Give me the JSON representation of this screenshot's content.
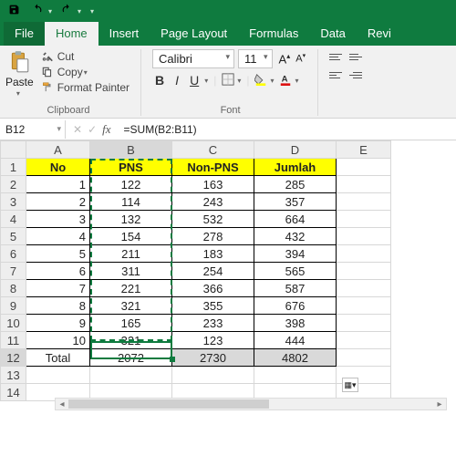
{
  "titlebar": {},
  "menu": {
    "file": "File",
    "home": "Home",
    "insert": "Insert",
    "pagelayout": "Page Layout",
    "formulas": "Formulas",
    "data": "Data",
    "review": "Revi"
  },
  "ribbon": {
    "clipboard": {
      "paste": "Paste",
      "cut": "Cut",
      "copy": "Copy",
      "formatpainter": "Format Painter",
      "label": "Clipboard"
    },
    "font": {
      "name": "Calibri",
      "size": "11",
      "bold": "B",
      "italic": "I",
      "underline": "U",
      "label": "Font"
    }
  },
  "fbar": {
    "namebox": "B12",
    "fx": "fx",
    "formula": "=SUM(B2:B11)"
  },
  "columns": [
    "A",
    "B",
    "C",
    "D",
    "E"
  ],
  "headers": {
    "no": "No",
    "pns": "PNS",
    "nonpns": "Non-PNS",
    "jumlah": "Jumlah"
  },
  "rows": [
    {
      "no": 1,
      "pns": 122,
      "nonpns": 163,
      "jumlah": 285
    },
    {
      "no": 2,
      "pns": 114,
      "nonpns": 243,
      "jumlah": 357
    },
    {
      "no": 3,
      "pns": 132,
      "nonpns": 532,
      "jumlah": 664
    },
    {
      "no": 4,
      "pns": 154,
      "nonpns": 278,
      "jumlah": 432
    },
    {
      "no": 5,
      "pns": 211,
      "nonpns": 183,
      "jumlah": 394
    },
    {
      "no": 6,
      "pns": 311,
      "nonpns": 254,
      "jumlah": 565
    },
    {
      "no": 7,
      "pns": 221,
      "nonpns": 366,
      "jumlah": 587
    },
    {
      "no": 8,
      "pns": 321,
      "nonpns": 355,
      "jumlah": 676
    },
    {
      "no": 9,
      "pns": 165,
      "nonpns": 233,
      "jumlah": 398
    },
    {
      "no": 10,
      "pns": 321,
      "nonpns": 123,
      "jumlah": 444
    }
  ],
  "total": {
    "label": "Total",
    "pns": 2072,
    "nonpns": 2730,
    "jumlah": 4802
  },
  "rownums": [
    "1",
    "2",
    "3",
    "4",
    "5",
    "6",
    "7",
    "8",
    "9",
    "10",
    "11",
    "12",
    "13",
    "14"
  ]
}
